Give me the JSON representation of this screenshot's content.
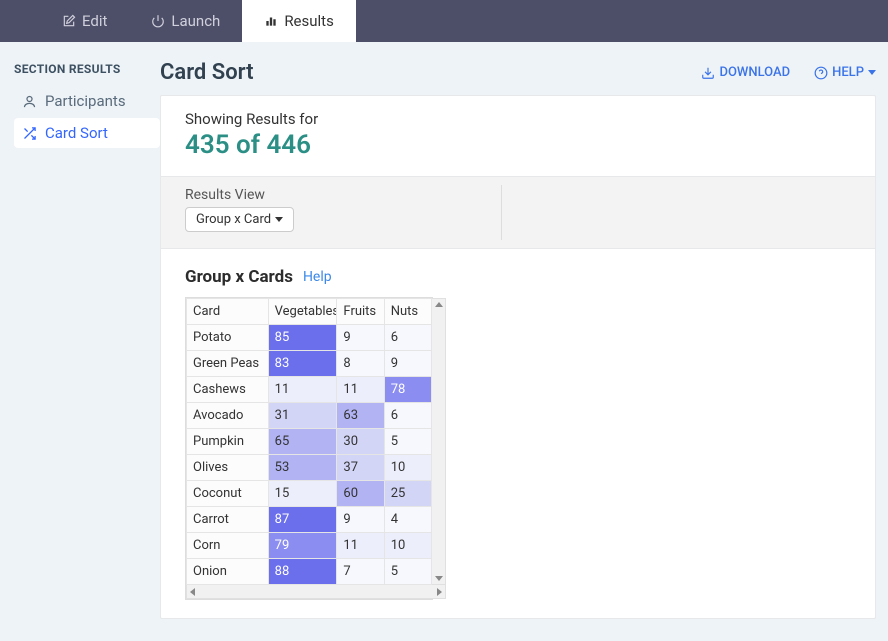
{
  "nav": {
    "tabs": [
      {
        "label": "Edit"
      },
      {
        "label": "Launch"
      },
      {
        "label": "Results"
      }
    ]
  },
  "sidebar": {
    "title": "SECTION RESULTS",
    "items": [
      {
        "label": "Participants"
      },
      {
        "label": "Card Sort"
      }
    ]
  },
  "header": {
    "title": "Card Sort",
    "download": "DOWNLOAD",
    "help": "HELP"
  },
  "summary": {
    "label": "Showing Results for",
    "value": "435 of 446"
  },
  "view": {
    "label": "Results View",
    "selected": "Group x Card"
  },
  "table": {
    "title": "Group x Cards",
    "help": "Help",
    "columns": [
      "Card",
      "Vegetables",
      "Fruits",
      "Nuts"
    ],
    "rows": [
      {
        "card": "Potato",
        "veg": 85,
        "fru": 9,
        "nut": 6
      },
      {
        "card": "Green Peas",
        "veg": 83,
        "fru": 8,
        "nut": 9
      },
      {
        "card": "Cashews",
        "veg": 11,
        "fru": 11,
        "nut": 78
      },
      {
        "card": "Avocado",
        "veg": 31,
        "fru": 63,
        "nut": 6
      },
      {
        "card": "Pumpkin",
        "veg": 65,
        "fru": 30,
        "nut": 5
      },
      {
        "card": "Olives",
        "veg": 53,
        "fru": 37,
        "nut": 10
      },
      {
        "card": "Coconut",
        "veg": 15,
        "fru": 60,
        "nut": 25
      },
      {
        "card": "Carrot",
        "veg": 87,
        "fru": 9,
        "nut": 4
      },
      {
        "card": "Corn",
        "veg": 79,
        "fru": 11,
        "nut": 10
      },
      {
        "card": "Onion",
        "veg": 88,
        "fru": 7,
        "nut": 5
      }
    ]
  },
  "chart_data": {
    "type": "heatmap",
    "title": "Group x Cards",
    "xlabel": "Group",
    "ylabel": "Card",
    "x": [
      "Vegetables",
      "Fruits",
      "Nuts"
    ],
    "y": [
      "Potato",
      "Green Peas",
      "Cashews",
      "Avocado",
      "Pumpkin",
      "Olives",
      "Coconut",
      "Carrot",
      "Corn",
      "Onion"
    ],
    "values": [
      [
        85,
        9,
        6
      ],
      [
        83,
        8,
        9
      ],
      [
        11,
        11,
        78
      ],
      [
        31,
        63,
        6
      ],
      [
        65,
        30,
        5
      ],
      [
        53,
        37,
        10
      ],
      [
        15,
        60,
        25
      ],
      [
        87,
        9,
        4
      ],
      [
        79,
        11,
        10
      ],
      [
        88,
        7,
        5
      ]
    ]
  }
}
